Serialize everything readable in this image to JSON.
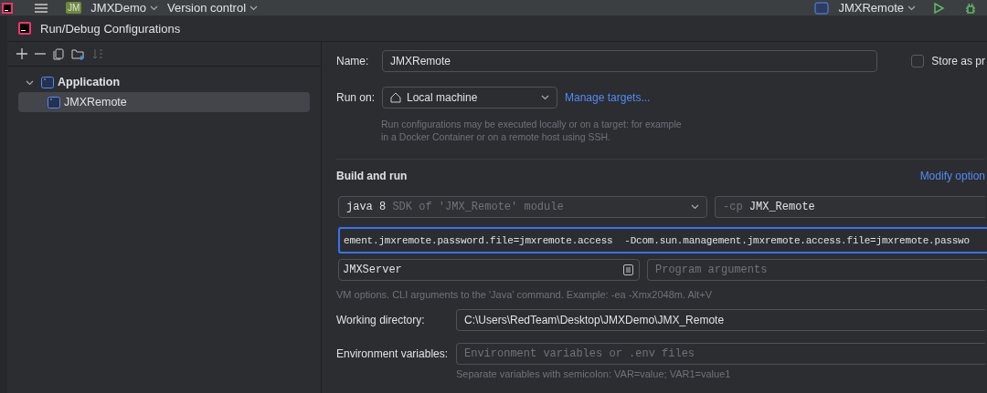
{
  "top_bar": {
    "project_badge": "JM",
    "project": "JMXDemo",
    "vcs": "Version control",
    "run_config": "JMXRemote"
  },
  "dialog": {
    "title": "Run/Debug Configurations"
  },
  "tree": [
    {
      "label": "Application",
      "expanded": true,
      "selected": false,
      "children": [
        {
          "label": "JMXRemote",
          "selected": true
        }
      ]
    }
  ],
  "form": {
    "name_label": "Name:",
    "name_value": "JMXRemote",
    "store": {
      "label": "Store as pr",
      "checked": false
    },
    "run_on_label": "Run on:",
    "run_on_value": "Local machine",
    "manage_link": "Manage targets...",
    "run_on_hint": "Run configurations may be executed locally or on a target: for example in a Docker Container or on a remote host using SSH.",
    "section_title": "Build and run",
    "modify_link": "Modify option",
    "jdk_value": "java 8",
    "jdk_hint": "SDK of 'JMX_Remote' module",
    "cp_prefix": "-cp",
    "cp_value": "JMX_Remote",
    "vm_options": "ement.jmxremote.password.file=jmxremote.access  -Dcom.sun.management.jmxremote.access.file=jmxremote.passwo",
    "main_class": "JMXServer",
    "program_args_placeholder": "Program arguments",
    "vm_hint": "VM options. CLI arguments to the 'Java' command. Example: -ea -Xmx2048m. Alt+V",
    "workdir_label": "Working directory:",
    "workdir_value": "C:\\Users\\RedTeam\\Desktop\\JMXDemo\\JMX_Remote",
    "env_label": "Environment variables:",
    "env_placeholder": "Environment variables or .env files",
    "env_hint": "Separate variables with semicolon: VAR=value; VAR1=value1"
  }
}
